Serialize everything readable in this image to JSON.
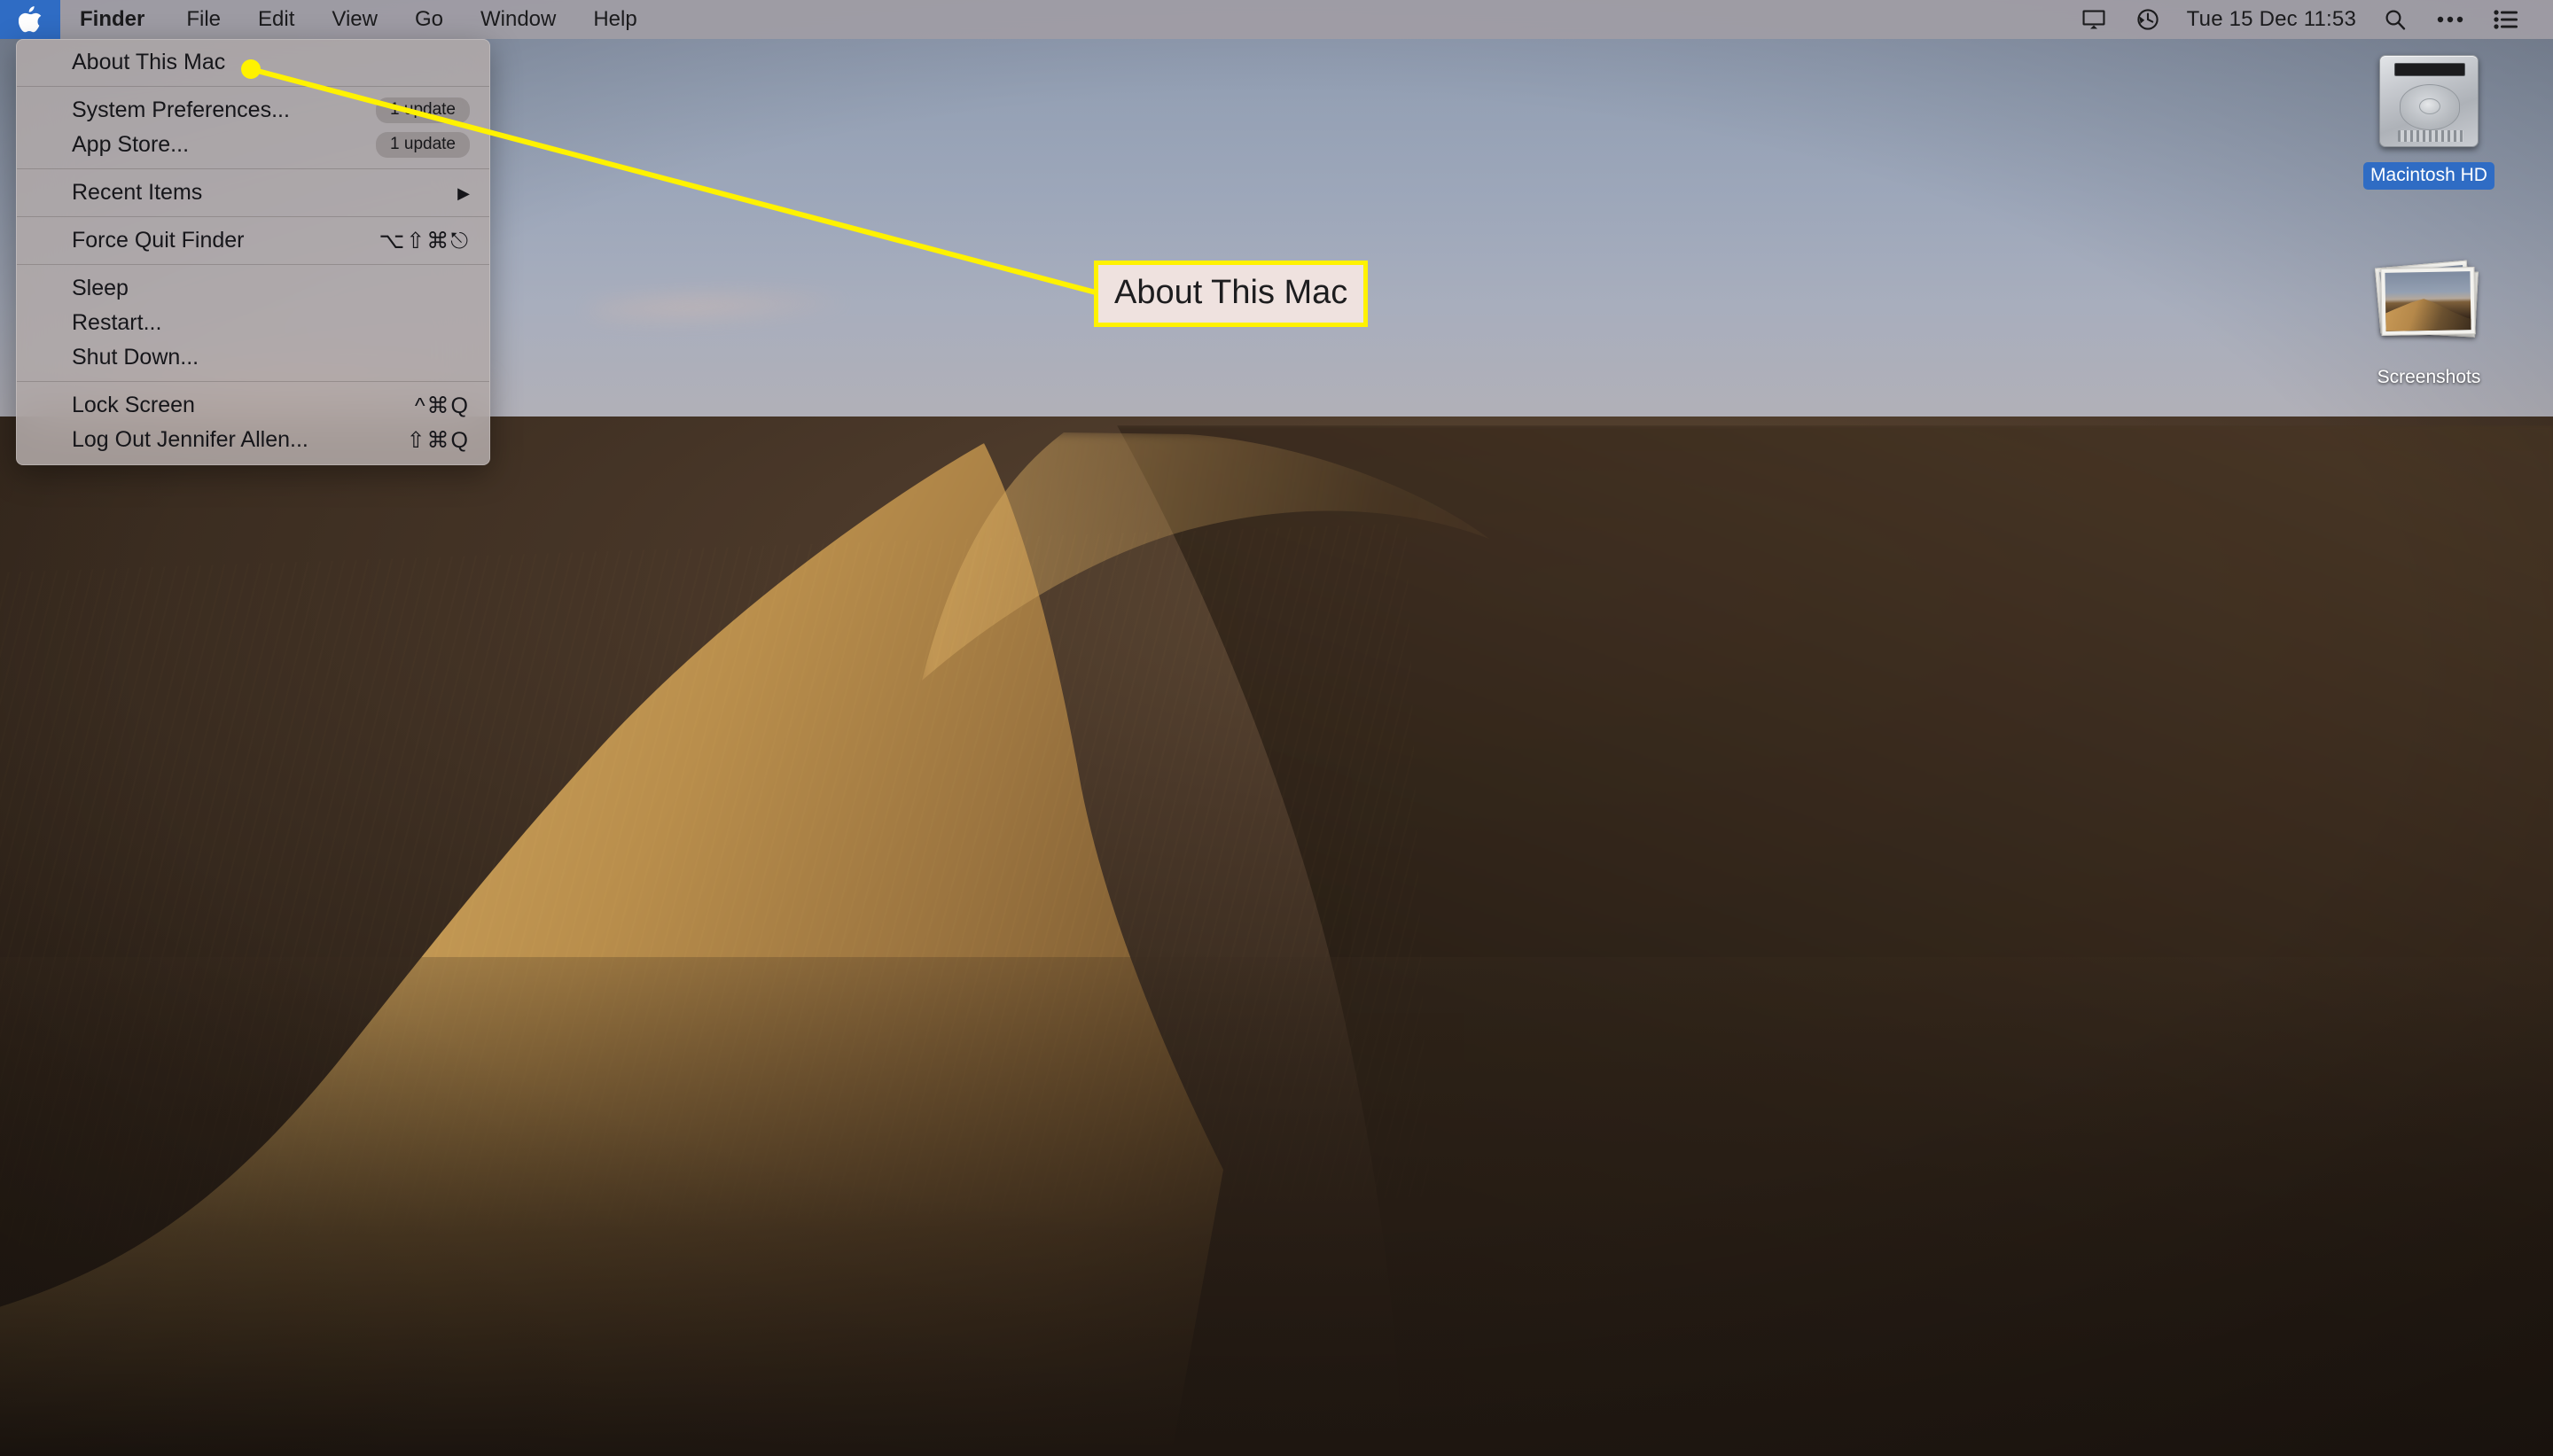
{
  "menubar": {
    "apple_icon": "apple-logo-icon",
    "items": [
      {
        "label": "Finder",
        "bold": true
      },
      {
        "label": "File",
        "bold": false
      },
      {
        "label": "Edit",
        "bold": false
      },
      {
        "label": "View",
        "bold": false
      },
      {
        "label": "Go",
        "bold": false
      },
      {
        "label": "Window",
        "bold": false
      },
      {
        "label": "Help",
        "bold": false
      }
    ],
    "status": {
      "display_icon": "display-mirroring-icon",
      "timemachine_icon": "time-machine-icon",
      "clock": "Tue 15 Dec  11:53",
      "search_icon": "search-icon",
      "more_icon": "ellipsis-icon",
      "control_center_icon": "control-center-icon"
    }
  },
  "apple_menu": {
    "groups": [
      {
        "items": [
          {
            "label": "About This Mac",
            "shortcut": "",
            "badge": "",
            "submenu": false
          }
        ]
      },
      {
        "items": [
          {
            "label": "System Preferences...",
            "shortcut": "",
            "badge": "1 update",
            "submenu": false
          },
          {
            "label": "App Store...",
            "shortcut": "",
            "badge": "1 update",
            "submenu": false
          }
        ]
      },
      {
        "items": [
          {
            "label": "Recent Items",
            "shortcut": "",
            "badge": "",
            "submenu": true
          }
        ]
      },
      {
        "items": [
          {
            "label": "Force Quit Finder",
            "shortcut": "⌥⇧⌘⎋",
            "badge": "",
            "submenu": false
          }
        ]
      },
      {
        "items": [
          {
            "label": "Sleep",
            "shortcut": "",
            "badge": "",
            "submenu": false
          },
          {
            "label": "Restart...",
            "shortcut": "",
            "badge": "",
            "submenu": false
          },
          {
            "label": "Shut Down...",
            "shortcut": "",
            "badge": "",
            "submenu": false
          }
        ]
      },
      {
        "items": [
          {
            "label": "Lock Screen",
            "shortcut": "^⌘Q",
            "badge": "",
            "submenu": false
          },
          {
            "label": "Log Out Jennifer Allen...",
            "shortcut": "⇧⌘Q",
            "badge": "",
            "submenu": false
          }
        ]
      }
    ]
  },
  "desktop": {
    "icons": [
      {
        "label": "Macintosh HD",
        "type": "hard-drive",
        "selected": true
      },
      {
        "label": "Screenshots",
        "type": "photo-stack",
        "selected": false
      }
    ]
  },
  "annotation": {
    "callout_text": "About This Mac",
    "line_color": "#fff200",
    "box_fill": "#efe2df",
    "box_border": "#fff200"
  },
  "colors": {
    "menubar_bg": "#a09da5",
    "menu_bg": "#b0a8a7",
    "accent_blue": "#2f6cc4",
    "highlight_yellow": "#fff200",
    "selected_label": "#2f6cc4"
  }
}
